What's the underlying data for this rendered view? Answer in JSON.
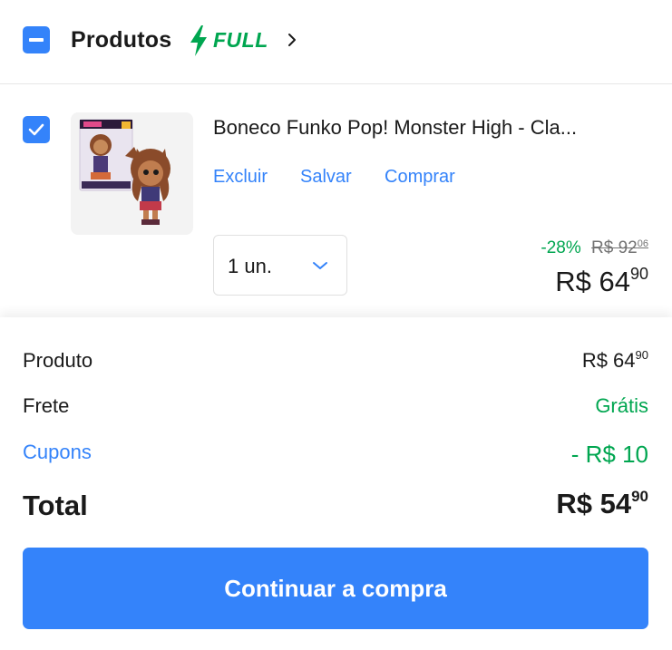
{
  "header": {
    "title": "Produtos",
    "badge": "FULL",
    "badge_color": "#00a650",
    "icons": [
      "checkbox-partial-icon",
      "bolt-icon",
      "chevron-right-icon"
    ]
  },
  "item": {
    "title": "Boneco Funko Pop! Monster High - Cla...",
    "checked": true,
    "actions": {
      "delete": "Excluir",
      "save": "Salvar",
      "buy": "Comprar"
    },
    "quantity": "1 un.",
    "discount": "-28%",
    "old_price_main": "R$ 92",
    "old_price_cents": "06",
    "price_main": "R$ 64",
    "price_cents": "90"
  },
  "summary": {
    "product_label": "Produto",
    "product_value_main": "R$ 64",
    "product_value_cents": "90",
    "shipping_label": "Frete",
    "shipping_value": "Grátis",
    "coupons_label": "Cupons",
    "coupons_value": "- R$ 10",
    "total_label": "Total",
    "total_main": "R$ 54",
    "total_cents": "90",
    "continue_button": "Continuar a compra"
  },
  "colors": {
    "accent": "#3483fa",
    "success": "#00a650",
    "muted": "#737373"
  }
}
